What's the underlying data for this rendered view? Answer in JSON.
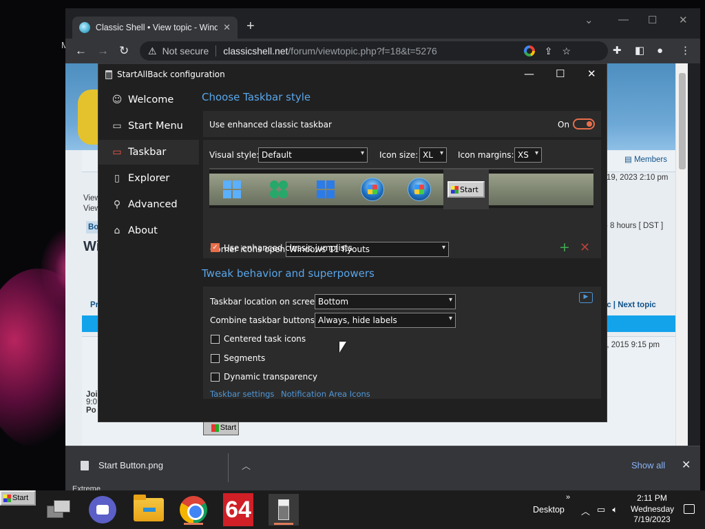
{
  "desktop": {
    "partial_text": "M"
  },
  "browser": {
    "tab_title": "Classic Shell • View topic - Windo",
    "url_warning": "Not secure",
    "url_host": "classicshell.net",
    "url_path": "/forum/viewtopic.php?f=18&t=5276",
    "webpage": {
      "search_partial": "ch",
      "members": "Members",
      "date1": "19, 2023 2:10 pm",
      "view1": "View",
      "view2": "View",
      "board_partial": "Bo",
      "heading_partial": "Wi",
      "timezone": "- 8 hours [ DST ]",
      "topic_nav_prev_partial": "Pr",
      "topic_nav": "pic | Next topic",
      "date2": "9, 2015 9:15 pm",
      "join_partial": "Joi",
      "time_partial": "9:0",
      "posts_partial": "Po",
      "start_image_label": "Start"
    },
    "download": {
      "filename": "Start Button.png",
      "show_all": "Show all",
      "extreme": "Extreme"
    }
  },
  "sab": {
    "title": "StartAllBack configuration",
    "nav": [
      {
        "label": "Welcome",
        "icon": "smiley-icon"
      },
      {
        "label": "Start Menu",
        "icon": "start-menu-icon"
      },
      {
        "label": "Taskbar",
        "icon": "taskbar-icon",
        "selected": true
      },
      {
        "label": "Explorer",
        "icon": "folder-icon"
      },
      {
        "label": "Advanced",
        "icon": "wrench-icon"
      },
      {
        "label": "About",
        "icon": "about-icon"
      }
    ],
    "section1": {
      "heading": "Choose Taskbar style",
      "enhanced_label": "Use enhanced classic taskbar",
      "toggle_state": "On",
      "visual_style_label": "Visual style:",
      "visual_style_value": "Default",
      "icon_size_label": "Icon size:",
      "icon_size_value": "XL",
      "icon_margins_label": "Icon margins:",
      "icon_margins_value": "XS",
      "start_button_styles": [
        "windows11",
        "clover",
        "windows10",
        "vista-orb",
        "seven-orb",
        "xp-start"
      ],
      "selected_style": "xp-start",
      "xp_start_label": "Start",
      "corner_label": "Corner icons open:",
      "corner_value": "Windows 11 flyouts",
      "jumplists_label": "Use enhanced classic jumplists",
      "jumplists_checked": true
    },
    "section2": {
      "heading": "Tweak behavior and superpowers",
      "location_label": "Taskbar location on screen:",
      "location_value": "Bottom",
      "combine_label": "Combine taskbar buttons:",
      "combine_value": "Always, hide labels",
      "centered_label": "Centered task icons",
      "centered_checked": false,
      "segments_label": "Segments",
      "segments_checked": false,
      "transparency_label": "Dynamic transparency",
      "transparency_checked": false,
      "link_taskbar_settings": "Taskbar settings",
      "link_notification_icons": "Notification Area Icons"
    }
  },
  "taskbar": {
    "start_label": "Start",
    "desktop_label": "Desktop",
    "time": "2:11 PM",
    "day": "Wednesday",
    "date": "7/19/2023",
    "app64_label": "64"
  },
  "colors": {
    "accent": "#e86e4a",
    "link": "#4f97d8",
    "heading": "#5aa6ea"
  }
}
